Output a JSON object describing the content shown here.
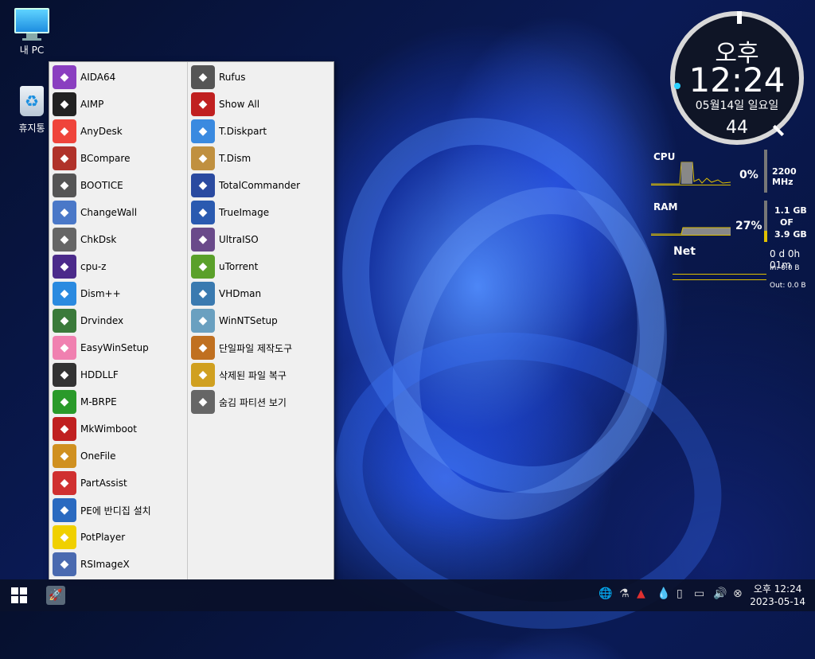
{
  "desktop": {
    "icons": [
      {
        "label": "내 PC",
        "icon": "monitor-icon"
      },
      {
        "label": "휴지통",
        "icon": "recycle-bin-icon"
      }
    ]
  },
  "menu": {
    "col1": [
      {
        "label": "AIDA64",
        "icon": "aida64-icon",
        "color": "#8a3fc0"
      },
      {
        "label": "AIMP",
        "icon": "aimp-icon",
        "color": "#222222"
      },
      {
        "label": "AnyDesk",
        "icon": "anydesk-icon",
        "color": "#ef443b"
      },
      {
        "label": "BCompare",
        "icon": "bcompare-icon",
        "color": "#b0322a"
      },
      {
        "label": "BOOTICE",
        "icon": "bootice-icon",
        "color": "#555555"
      },
      {
        "label": "ChangeWall",
        "icon": "changewall-icon",
        "color": "#4a78c8"
      },
      {
        "label": "ChkDsk",
        "icon": "chkdsk-icon",
        "color": "#666666"
      },
      {
        "label": "cpu-z",
        "icon": "cpuz-icon",
        "color": "#4b2a8a"
      },
      {
        "label": "Dism++",
        "icon": "dism-plus-icon",
        "color": "#2a8ae0"
      },
      {
        "label": "Drvindex",
        "icon": "drvindex-icon",
        "color": "#3a7a3a"
      },
      {
        "label": "EasyWinSetup",
        "icon": "easywinsetup-icon",
        "color": "#f080b0"
      },
      {
        "label": "HDDLLF",
        "icon": "hddllf-icon",
        "color": "#333333"
      },
      {
        "label": "M-BRPE",
        "icon": "mbrpe-icon",
        "color": "#2a9a2a"
      },
      {
        "label": "MkWimboot",
        "icon": "mkwimboot-icon",
        "color": "#c02020"
      },
      {
        "label": "OneFile",
        "icon": "onefile-icon",
        "color": "#d09020"
      },
      {
        "label": "PartAssist",
        "icon": "partassist-icon",
        "color": "#d03030"
      },
      {
        "label": "PE에 반디집 설치",
        "icon": "bandizip-installer-icon",
        "color": "#2a6ac0"
      },
      {
        "label": "PotPlayer",
        "icon": "potplayer-icon",
        "color": "#f0d000"
      },
      {
        "label": "RSImageX",
        "icon": "rsimagex-icon",
        "color": "#4a6ab0"
      }
    ],
    "col2": [
      {
        "label": "Rufus",
        "icon": "rufus-icon",
        "color": "#555555"
      },
      {
        "label": "Show All",
        "icon": "show-all-icon",
        "color": "#c02020"
      },
      {
        "label": "T.Diskpart",
        "icon": "tdiskpart-icon",
        "color": "#3a8ae0"
      },
      {
        "label": "T.Dism",
        "icon": "tdism-icon",
        "color": "#c09040"
      },
      {
        "label": "TotalCommander",
        "icon": "totalcommander-icon",
        "color": "#2a4aa0"
      },
      {
        "label": "TrueImage",
        "icon": "trueimage-icon",
        "color": "#2a5ab0"
      },
      {
        "label": "UltraISO",
        "icon": "ultraiso-icon",
        "color": "#6a4a8a"
      },
      {
        "label": "uTorrent",
        "icon": "utorrent-icon",
        "color": "#5aa02a"
      },
      {
        "label": "VHDman",
        "icon": "vhdman-icon",
        "color": "#3a7ab0"
      },
      {
        "label": "WinNTSetup",
        "icon": "winntsetup-icon",
        "color": "#6aa0c0"
      },
      {
        "label": "단일파일 제작도구",
        "icon": "single-file-maker-icon",
        "color": "#c07020"
      },
      {
        "label": "삭제된 파일 복구",
        "icon": "file-recovery-icon",
        "color": "#d0a020"
      },
      {
        "label": "숨김 파티션 보기",
        "icon": "hidden-partition-icon",
        "color": "#666666"
      }
    ]
  },
  "clock_gadget": {
    "ampm": "오후",
    "time": "12:24",
    "date": "05월14일 일요일",
    "seconds": "44"
  },
  "system_meter": {
    "cpu_label": "CPU",
    "cpu_percent": "0%",
    "cpu_freq": "2200 MHz",
    "ram_label": "RAM",
    "ram_percent": "27%",
    "ram_used": "1.1 GB",
    "ram_of": "OF",
    "ram_total": "3.9 GB",
    "net_label": "Net",
    "uptime": "0 d 0h 01m",
    "net_in": "In: 0.0 B",
    "net_out": "Out: 0.0 B",
    "accent_color": "#e0c000"
  },
  "taskbar": {
    "tray_icons": [
      "globe-icon",
      "usb-tool-icon",
      "network-triangle-icon",
      "drop-icon",
      "usb-drive-icon",
      "battery-icon",
      "speaker-icon",
      "close-circle-icon"
    ],
    "clock_ampm_time": "오후 12:24",
    "clock_date": "2023-05-14"
  }
}
